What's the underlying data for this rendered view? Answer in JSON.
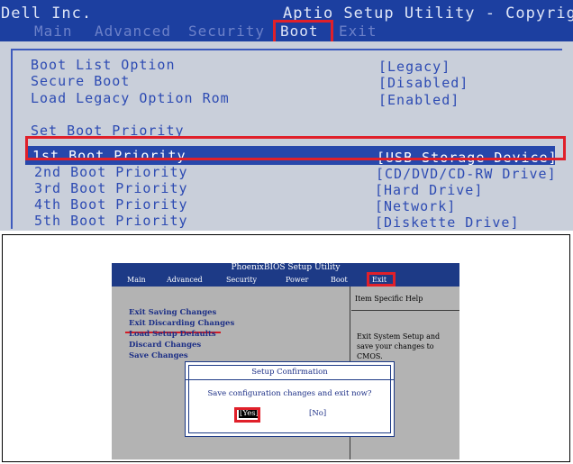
{
  "aptio": {
    "vendor": "Dell Inc.",
    "title": "Aptio Setup Utility - Copyright",
    "tabs": [
      {
        "label": "Main"
      },
      {
        "label": "Advanced"
      },
      {
        "label": "Security"
      },
      {
        "label": "Boot"
      },
      {
        "label": "Exit"
      }
    ],
    "settings": [
      {
        "label": "Boot List Option",
        "value": "[Legacy]"
      },
      {
        "label": "Secure Boot",
        "value": "[Disabled]"
      },
      {
        "label": "Load Legacy Option Rom",
        "value": "[Enabled]"
      }
    ],
    "priority_heading": "Set Boot Priority",
    "priorities": [
      {
        "label": "1st Boot Priority",
        "value": "[USB Storage Device]"
      },
      {
        "label": "2nd Boot Priority",
        "value": "[CD/DVD/CD-RW Drive]"
      },
      {
        "label": "3rd Boot Priority",
        "value": "[Hard Drive]"
      },
      {
        "label": "4th Boot Priority",
        "value": "[Network]"
      },
      {
        "label": "5th Boot Priority",
        "value": "[Diskette Drive]"
      }
    ],
    "colors": {
      "header": "#1c3fa0",
      "body": "#c9cfda",
      "text": "#2d4bb3",
      "highlight": "#e0202a"
    }
  },
  "phoenix": {
    "title": "PhoenixBIOS Setup Utility",
    "menus": [
      {
        "label": "Main"
      },
      {
        "label": "Advanced"
      },
      {
        "label": "Security"
      },
      {
        "label": "Power"
      },
      {
        "label": "Boot"
      },
      {
        "label": "Exit"
      }
    ],
    "options": [
      {
        "label": "Exit Saving Changes"
      },
      {
        "label": "Exit Discarding Changes"
      },
      {
        "label": "Load Setup Defaults"
      },
      {
        "label": "Discard Changes"
      },
      {
        "label": "Save Changes"
      }
    ],
    "help": {
      "title": "Item Specific Help",
      "lines": [
        "Exit System Setup and",
        "save your changes to",
        "CMOS."
      ]
    },
    "dialog": {
      "title": "Setup Confirmation",
      "message": "Save configuration changes and exit now?",
      "yes": "[Yes]",
      "no": "[No]"
    }
  }
}
